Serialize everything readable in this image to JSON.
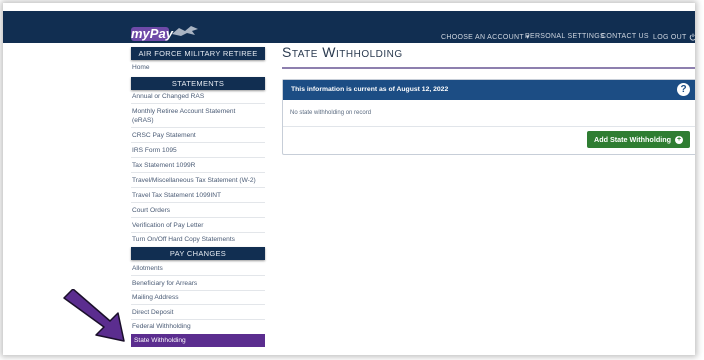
{
  "app": {
    "logo_text": "myPay"
  },
  "topnav": [
    {
      "label": "CHOOSE AN ACCOUNT ▾"
    },
    {
      "label": "PERSONAL SETTINGS"
    },
    {
      "label": "CONTACT US"
    },
    {
      "label": "LOG OUT"
    }
  ],
  "sidebar": {
    "account_header": "AIR FORCE MILITARY RETIREE",
    "home": "Home",
    "statements_header": "STATEMENTS",
    "statements": [
      "Annual or Changed RAS",
      "Monthly Retiree Account Statement",
      "(eRAS)",
      "CRSC Pay Statement",
      "IRS Form 1095",
      "Tax Statement 1099R",
      "Travel/Miscellaneous Tax Statement (W-2)",
      "Travel Tax Statement 1099INT",
      "Court Orders",
      "Verification of Pay Letter",
      "Turn On/Off Hard Copy Statements"
    ],
    "pay_changes_header": "PAY CHANGES",
    "pay_changes": [
      "Allotments",
      "Beneficiary for Arrears",
      "Mailing Address",
      "Direct Deposit",
      "Federal Withholding",
      "State Withholding"
    ]
  },
  "main": {
    "page_title": "State Withholding",
    "panel": {
      "header_text": "This information is current as of August 12, 2022",
      "help_glyph": "?",
      "body_text": "No state withholding on record",
      "add_button_label": "Add State Withholding",
      "add_button_icon": "+"
    }
  },
  "colors": {
    "topbar": "#112e51",
    "panel_header": "#1c4d84",
    "selected_item": "#5b2d8f",
    "add_button": "#2f7d32",
    "annotation_arrow": "#5b2d8f"
  },
  "icons": {
    "logo": "eagle-logo-icon",
    "logout": "power-icon",
    "help": "question-circle-icon",
    "add": "plus-circle-icon",
    "annotation": "arrow-pointer-icon"
  }
}
